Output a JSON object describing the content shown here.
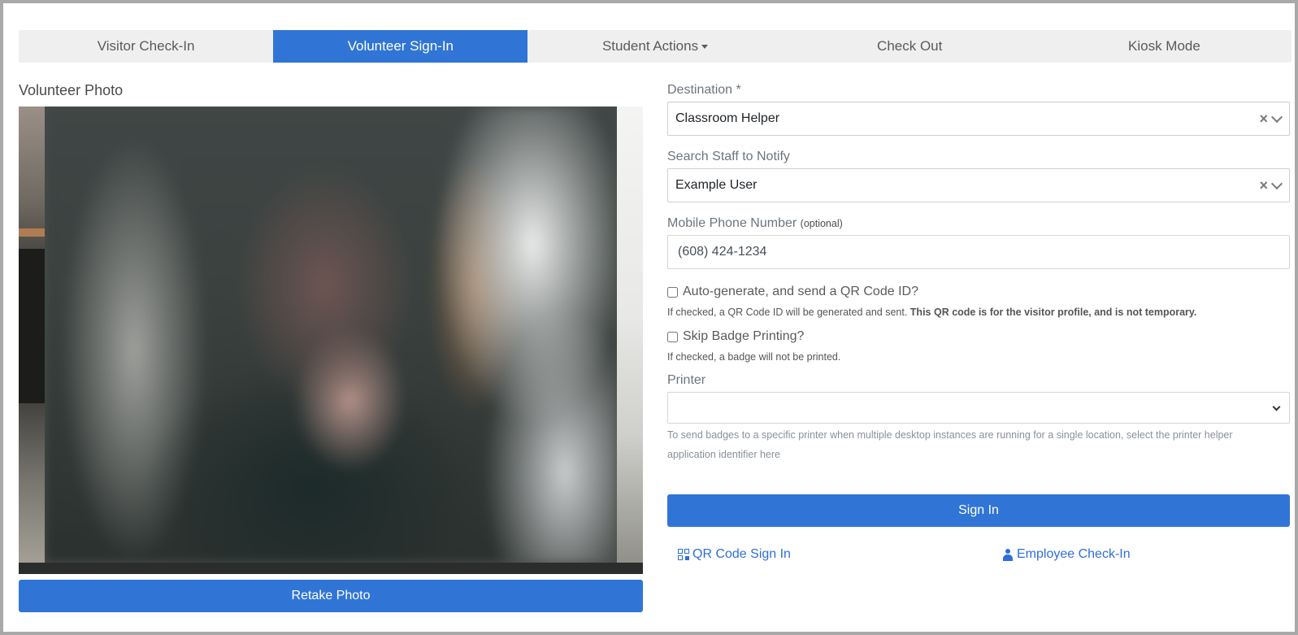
{
  "tabs": [
    {
      "label": "Visitor Check-In",
      "active": false
    },
    {
      "label": "Volunteer Sign-In",
      "active": true
    },
    {
      "label": "Student Actions",
      "active": false,
      "dropdown": true
    },
    {
      "label": "Check Out",
      "active": false
    },
    {
      "label": "Kiosk Mode",
      "active": false
    }
  ],
  "photo": {
    "label": "Volunteer Photo",
    "retake_label": "Retake Photo"
  },
  "form": {
    "destination": {
      "label": "Destination *",
      "value": "Classroom Helper"
    },
    "staff": {
      "label": "Search Staff to Notify",
      "value": "Example User"
    },
    "phone": {
      "label": "Mobile Phone Number",
      "optional": "(optional)",
      "value": "(608) 424-1234"
    },
    "qr_checkbox": {
      "label": "Auto-generate, and send a QR Code ID?",
      "checked": false,
      "help": "If checked, a QR Code ID will be generated and sent.",
      "help_bold": "This QR code is for the visitor profile, and is not temporary."
    },
    "badge_checkbox": {
      "label": "Skip Badge Printing?",
      "checked": false,
      "help": "If checked, a badge will not be printed."
    },
    "printer": {
      "label": "Printer",
      "value": "",
      "help": "To send badges to a specific printer when multiple desktop instances are running for a single location, select the printer helper application identifier here"
    },
    "signin_label": "Sign In"
  },
  "links": {
    "qr_signin": "QR Code Sign In",
    "employee_checkin": "Employee Check-In"
  },
  "colors": {
    "primary": "#3075d6",
    "link": "#2f6fd8",
    "tab_bg": "#efefef"
  }
}
